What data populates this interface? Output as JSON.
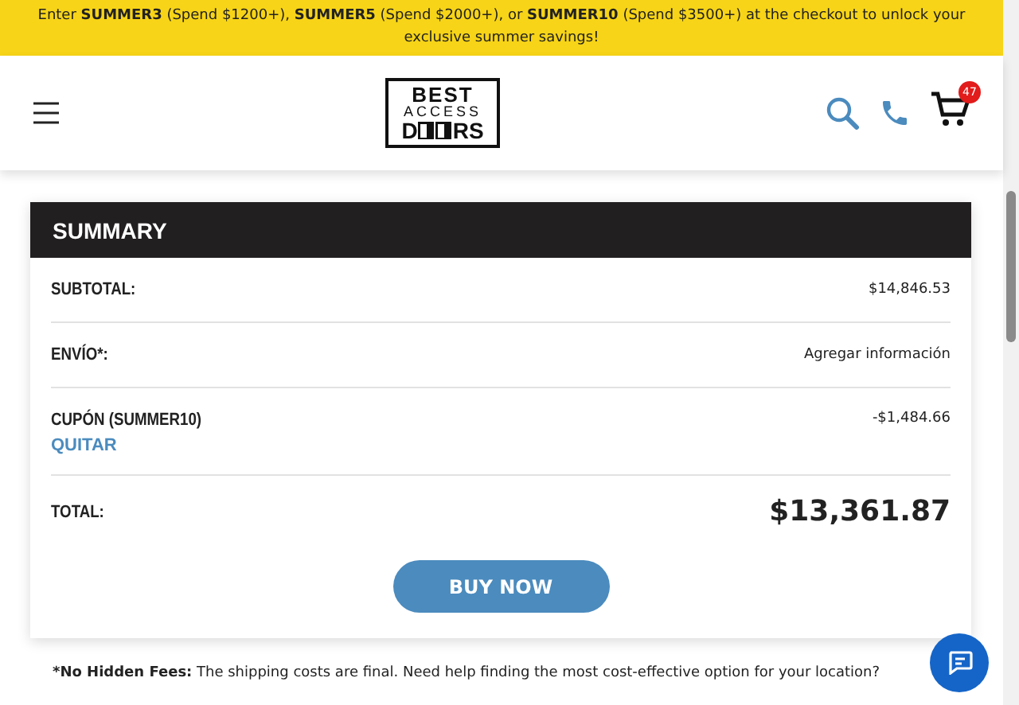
{
  "promo_banner": {
    "text": "Enter **SUMMER3** (Spend $1200+), **SUMMER5** (Spend $2000+), or **SUMMER10** (Spend $3500+) at the checkout to unlock your exclusive summer savings!"
  },
  "header": {
    "logo": {
      "top": "BEST",
      "middle": "ACCESS",
      "bottom_left": "D",
      "bottom_right": "RS"
    },
    "cart_count": "47"
  },
  "summary": {
    "title": "SUMMARY",
    "rows": [
      {
        "kind": "line",
        "label": "SUBTOTAL:",
        "value": "$14,846.53"
      },
      {
        "kind": "line",
        "label": "ENVÍO*:",
        "value": "Agregar información"
      },
      {
        "kind": "coupon",
        "label": "CUPÓN (SUMMER10)",
        "link": "QUITAR",
        "value": "-$1,484.66"
      },
      {
        "kind": "total",
        "label": "TOTAL:",
        "value": "$13,361.87"
      }
    ],
    "button": "BUY NOW"
  },
  "note": "***No Hidden Fees:** The shipping costs are final. Need help finding the most cost-effective option for your location?"
}
